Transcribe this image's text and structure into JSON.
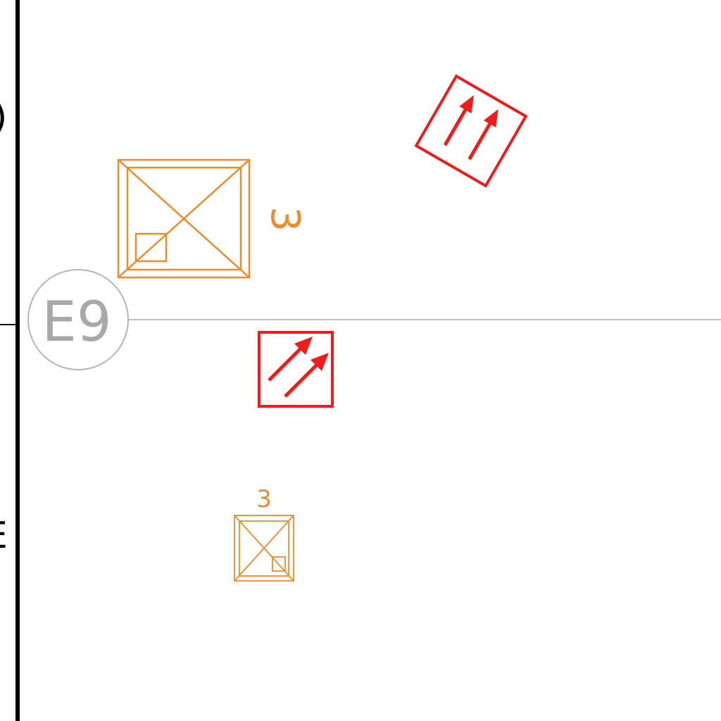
{
  "colors": {
    "background": "#ffffff",
    "wall": "#000000",
    "grid_line": "#aaaaaa",
    "grid_bubble": "#aaaaaa",
    "fixture": "#f08a2a",
    "exit_sign": "#ee1c1c"
  },
  "grid": {
    "bubble_label": "E9"
  },
  "edge_labels": {
    "top": ")",
    "bottom": "E"
  },
  "fixtures": [
    {
      "tag": "3",
      "kind": "large"
    },
    {
      "tag": "3",
      "kind": "small"
    }
  ],
  "exit_signs": [
    {
      "direction": "up-rotated"
    },
    {
      "direction": "diagonal-up-right"
    }
  ]
}
